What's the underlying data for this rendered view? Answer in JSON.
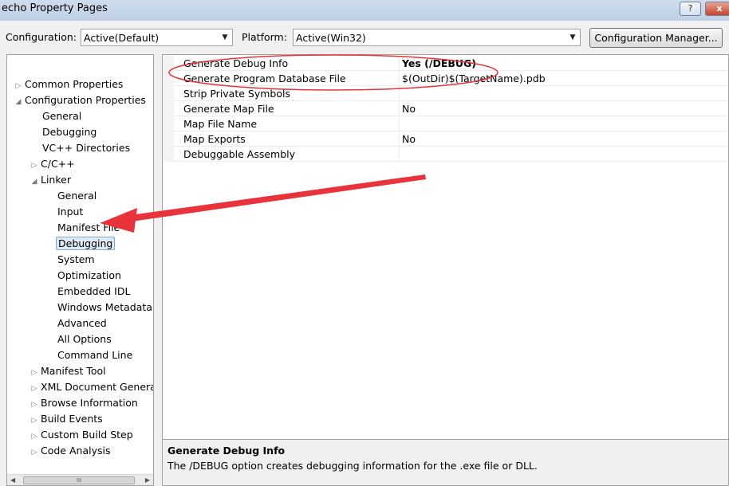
{
  "window": {
    "title": "echo Property Pages",
    "help_label": "?",
    "close_label": "x"
  },
  "toolbar": {
    "configuration_label": "Configuration:",
    "configuration_value": "Active(Default)",
    "platform_label": "Platform:",
    "platform_value": "Active(Win32)",
    "configuration_manager_label": "Configuration Manager..."
  },
  "tree": {
    "items": [
      {
        "label": "Common Properties",
        "expander": "▷"
      },
      {
        "label": "Configuration Properties",
        "expander": "◢"
      },
      {
        "label": "General",
        "expander": ""
      },
      {
        "label": "Debugging",
        "expander": ""
      },
      {
        "label": "VC++ Directories",
        "expander": ""
      },
      {
        "label": "C/C++",
        "expander": "▷"
      },
      {
        "label": "Linker",
        "expander": "◢"
      },
      {
        "label": "General",
        "expander": ""
      },
      {
        "label": "Input",
        "expander": ""
      },
      {
        "label": "Manifest File",
        "expander": ""
      },
      {
        "label": "Debugging",
        "expander": ""
      },
      {
        "label": "System",
        "expander": ""
      },
      {
        "label": "Optimization",
        "expander": ""
      },
      {
        "label": "Embedded IDL",
        "expander": ""
      },
      {
        "label": "Windows Metadata",
        "expander": ""
      },
      {
        "label": "Advanced",
        "expander": ""
      },
      {
        "label": "All Options",
        "expander": ""
      },
      {
        "label": "Command Line",
        "expander": ""
      },
      {
        "label": "Manifest Tool",
        "expander": "▷"
      },
      {
        "label": "XML Document Generat",
        "expander": "▷"
      },
      {
        "label": "Browse Information",
        "expander": "▷"
      },
      {
        "label": "Build Events",
        "expander": "▷"
      },
      {
        "label": "Custom Build Step",
        "expander": "▷"
      },
      {
        "label": "Code Analysis",
        "expander": "▷"
      }
    ],
    "scroll_thumb": "III"
  },
  "properties": [
    {
      "name": "Generate Debug Info",
      "value": "Yes (/DEBUG)"
    },
    {
      "name": "Generate Program Database File",
      "value": "$(OutDir)$(TargetName).pdb"
    },
    {
      "name": "Strip Private Symbols",
      "value": ""
    },
    {
      "name": "Generate Map File",
      "value": "No"
    },
    {
      "name": "Map File Name",
      "value": ""
    },
    {
      "name": "Map Exports",
      "value": "No"
    },
    {
      "name": "Debuggable Assembly",
      "value": ""
    }
  ],
  "description": {
    "title": "Generate Debug Info",
    "text": "The /DEBUG option creates debugging information for the .exe file or DLL."
  },
  "colors": {
    "annotation": "#e8333a",
    "selection_border": "#7fa8d6",
    "selection_fill": "#dfeaf7"
  }
}
